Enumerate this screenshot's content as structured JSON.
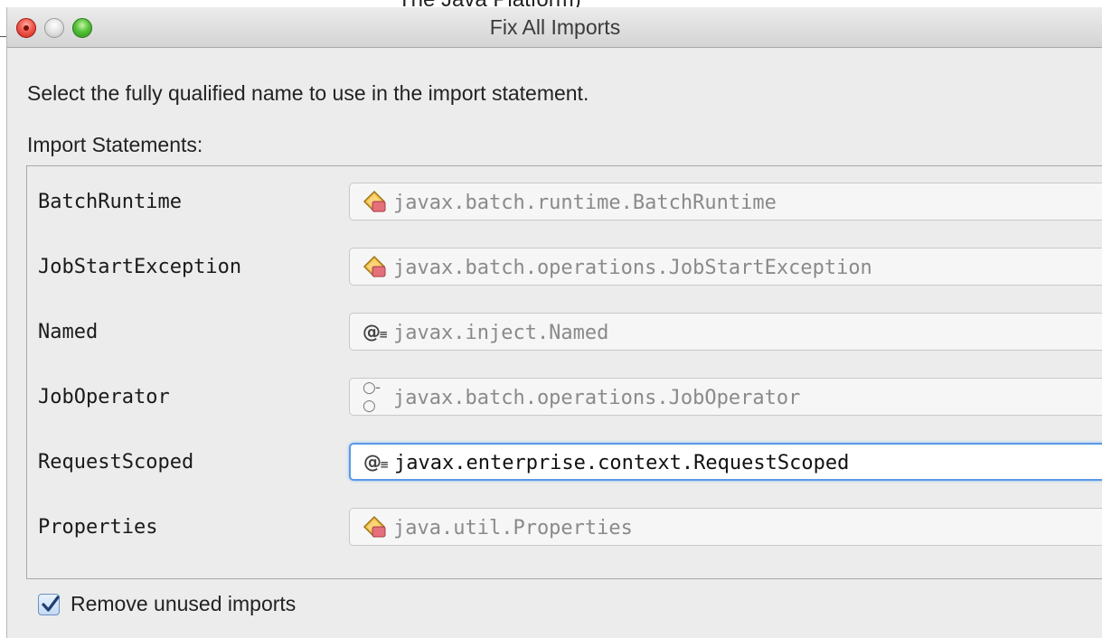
{
  "background": {
    "partial_text": "The Java Platform)"
  },
  "window": {
    "title": "Fix All Imports"
  },
  "dialog": {
    "instruction": "Select the fully qualified name to use in the import statement.",
    "group_label": "Import Statements:",
    "imports": [
      {
        "name": "BatchRuntime",
        "fqn": "javax.batch.runtime.BatchRuntime",
        "icon": "class-icon"
      },
      {
        "name": "JobStartException",
        "fqn": "javax.batch.operations.JobStartException",
        "icon": "class-icon"
      },
      {
        "name": "Named",
        "fqn": "javax.inject.Named",
        "icon": "annotation-icon"
      },
      {
        "name": "JobOperator",
        "fqn": "javax.batch.operations.JobOperator",
        "icon": "interface-icon"
      },
      {
        "name": "RequestScoped",
        "fqn": "javax.enterprise.context.RequestScoped",
        "icon": "annotation-icon",
        "focused": true
      },
      {
        "name": "Properties",
        "fqn": "java.util.Properties",
        "icon": "class-icon"
      }
    ],
    "remove_unused": {
      "label": "Remove unused imports",
      "checked": true
    }
  },
  "colors": {
    "focus_ring": "#5a9ae6",
    "class_icon_fill": "#f4c04a",
    "class_icon_badge": "#e3707a"
  }
}
